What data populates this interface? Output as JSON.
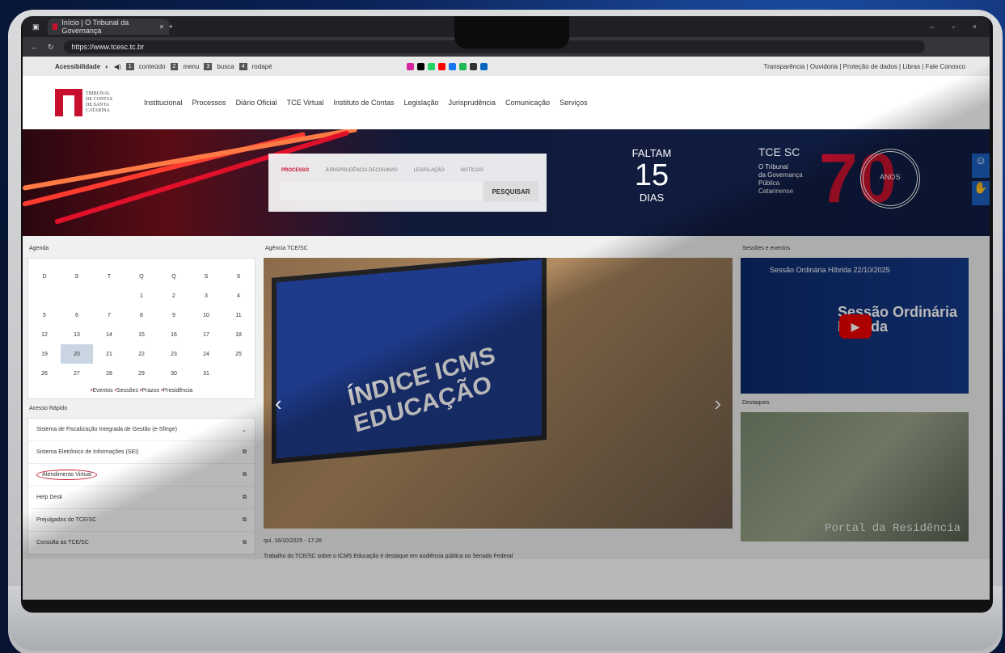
{
  "browser": {
    "tab_title": "Início | O Tribunal da Governança",
    "url": "https://www.tcesc.tc.br"
  },
  "acc": {
    "label": "Acessibilidade",
    "k1": "1",
    "l1": "conteúdo",
    "k2": "2",
    "l2": "menu",
    "k3": "3",
    "l3": "busca",
    "k4": "4",
    "l4": "rodapé",
    "links": "Transparência | Ouvidoria | Proteção de dados | Libras | Fale Conosco"
  },
  "logo": {
    "l1": "TRIBUNAL",
    "l2": "DE CONTAS",
    "l3": "DE SANTA",
    "l4": "CATARINA"
  },
  "nav": [
    "Institucional",
    "Processos",
    "Diário Oficial",
    "TCE Virtual",
    "Instituto de Contas",
    "Legislação",
    "Jurisprudência",
    "Comunicação",
    "Serviços"
  ],
  "search": {
    "tabs": [
      "PROCESSO",
      "JURISPRUDÊNCIA DECISUMAS",
      "LEGISLAÇÃO",
      "NOTÍCIAS"
    ],
    "button": "PESQUISAR"
  },
  "countdown": {
    "top": "FALTAM",
    "num": "15",
    "bottom": "DIAS"
  },
  "anniv": {
    "brand": "TCE SC",
    "tag1": "O Tribunal",
    "tag2": "da Governança",
    "tag3": "Pública",
    "tag4": "Catarinense",
    "num": "70",
    "ring": "ANOS"
  },
  "agenda": {
    "title": "Agenda",
    "days": [
      "D",
      "S",
      "T",
      "Q",
      "Q",
      "S",
      "S"
    ],
    "weeks": [
      [
        "",
        "",
        "",
        "1",
        "2",
        "3",
        "4"
      ],
      [
        "5",
        "6",
        "7",
        "8",
        "9",
        "10",
        "11"
      ],
      [
        "12",
        "13",
        "14",
        "15",
        "16",
        "17",
        "18"
      ],
      [
        "19",
        "20",
        "21",
        "22",
        "23",
        "24",
        "25"
      ],
      [
        "26",
        "27",
        "28",
        "29",
        "30",
        "31",
        ""
      ]
    ],
    "legend": [
      "Eventos",
      "Sessões",
      "Prazos",
      "Presidência"
    ]
  },
  "quick": {
    "title": "Acesso Rápido",
    "items": [
      "Sistema de Fiscalização Integrada de Gestão (e-Sfinge)",
      "Sistema Eletrônico de Informações (SEI)",
      "Atendimento Virtual",
      "Help Desk",
      "Prejulgados do TCE/SC",
      "Consulta ao TCE/SC"
    ]
  },
  "agency": {
    "title": "Agência TCE/SC",
    "headline": "ÍNDICE ICMS EDUCAÇÃO",
    "date": "qui, 16/10/2025 - 17:26",
    "news": "Trabalho do TCE/SC sobre o ICMS Educação é destaque em audiência pública no Senado Federal"
  },
  "sessions": {
    "title": "Sessões e eventos",
    "video_title": "Sessão Ordinária Híbrida 22/10/2025",
    "big": "Sessão Ordinária Híbrida"
  },
  "dest": {
    "title": "Destaques",
    "portal": "Portal da Residência"
  }
}
